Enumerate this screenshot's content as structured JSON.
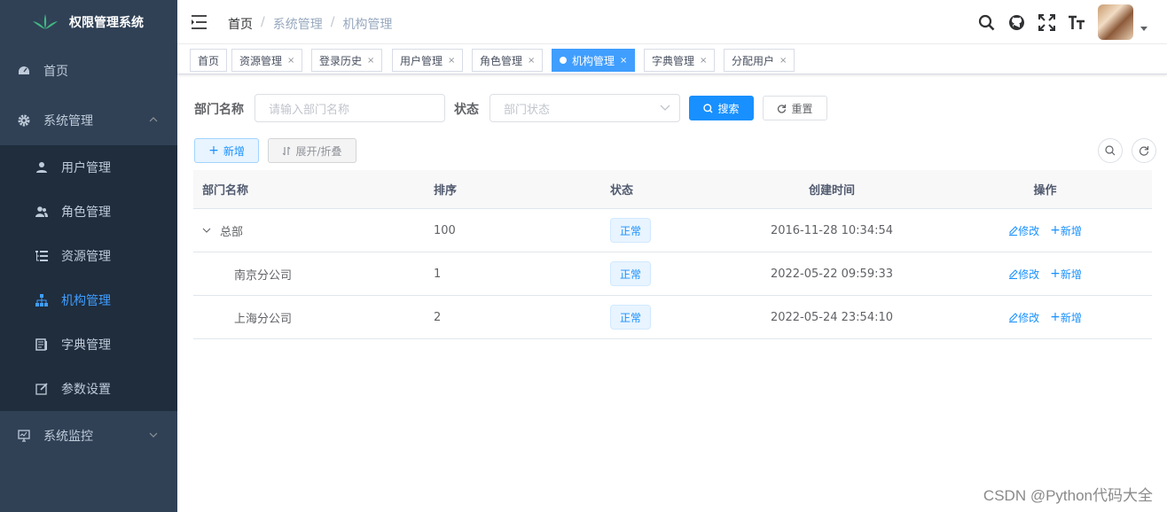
{
  "sidebar": {
    "logo_text": "权限管理系统",
    "items": [
      {
        "label": "首页",
        "icon": "dashboard-icon"
      },
      {
        "label": "系统管理",
        "icon": "gear-icon"
      },
      {
        "label": "系统监控",
        "icon": "monitor-icon"
      }
    ],
    "sub_items": [
      {
        "label": "用户管理",
        "icon": "user-icon"
      },
      {
        "label": "角色管理",
        "icon": "peoples-icon"
      },
      {
        "label": "资源管理",
        "icon": "tree-table-icon"
      },
      {
        "label": "机构管理",
        "icon": "tree-icon"
      },
      {
        "label": "字典管理",
        "icon": "dict-icon"
      },
      {
        "label": "参数设置",
        "icon": "edit-icon"
      }
    ],
    "active_color": "#409eff",
    "bg_color": "#304156"
  },
  "breadcrumb": [
    "首页",
    "系统管理",
    "机构管理"
  ],
  "tags": [
    "首页",
    "资源管理",
    "登录历史",
    "用户管理",
    "角色管理",
    "机构管理",
    "字典管理",
    "分配用户"
  ],
  "active_tag": "机构管理",
  "search": {
    "dept_label": "部门名称",
    "dept_placeholder": "请输入部门名称",
    "status_label": "状态",
    "status_placeholder": "部门状态",
    "search_btn": "搜索",
    "reset_btn": "重置"
  },
  "toolbar": {
    "add_btn": "新增",
    "toggle_btn": "展开/折叠"
  },
  "table": {
    "headers": [
      "部门名称",
      "排序",
      "状态",
      "创建时间",
      "操作"
    ],
    "rows": [
      {
        "name": "总部",
        "order": "100",
        "status": "正常",
        "time": "2016-11-28 10:34:54",
        "edit": "修改",
        "add": "新增"
      },
      {
        "name": "南京分公司",
        "order": "1",
        "status": "正常",
        "time": "2022-05-22 09:59:33",
        "edit": "修改",
        "add": "新增"
      },
      {
        "name": "上海分公司",
        "order": "2",
        "status": "正常",
        "time": "2022-05-24 23:54:10",
        "edit": "修改",
        "add": "新增"
      }
    ]
  },
  "watermark": "CSDN @Python代码大全",
  "primary_color": "#1890ff"
}
